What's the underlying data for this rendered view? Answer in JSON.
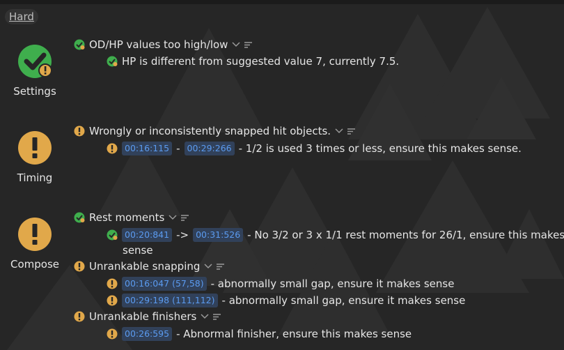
{
  "tab": {
    "label": "Hard"
  },
  "colors": {
    "ok": "#3fae4d",
    "warn": "#e1a84a",
    "timestamp_bg": "#31415a",
    "timestamp_text": "#5b9bf0"
  },
  "categories": [
    {
      "label": "Settings",
      "icon": "check-warning-icon"
    },
    {
      "label": "Timing",
      "icon": "warning-icon"
    },
    {
      "label": "Compose",
      "icon": "warning-icon"
    }
  ],
  "checks": {
    "odhp": {
      "title": "OD/HP values too high/low",
      "detail": "HP is different from suggested value 7, currently 7.5."
    },
    "snapped": {
      "title": "Wrongly or inconsistently snapped hit objects.",
      "ts1": "00:16:115",
      "sep": "-",
      "ts2": "00:29:266",
      "detail": "- 1/2 is used 3 times or less, ensure this makes sense."
    },
    "rest": {
      "title": "Rest moments",
      "ts1": "00:20:841",
      "sep": "->",
      "ts2": "00:31:526",
      "detail": "- No 3/2 or 3 x 1/1 rest moments for 26/1, ensure this makes",
      "detail_wrap": "sense"
    },
    "unrankable_snapping": {
      "title": "Unrankable snapping",
      "items": [
        {
          "ts": "00:16:047 (57,58)",
          "detail": "- abnormally small gap, ensure it makes sense"
        },
        {
          "ts": "00:29:198 (111,112)",
          "detail": "- abnormally small gap, ensure it makes sense"
        }
      ]
    },
    "unrankable_finishers": {
      "title": "Unrankable finishers",
      "ts": "00:26:595",
      "detail": "- Abnormal finisher, ensure this makes sense"
    }
  }
}
